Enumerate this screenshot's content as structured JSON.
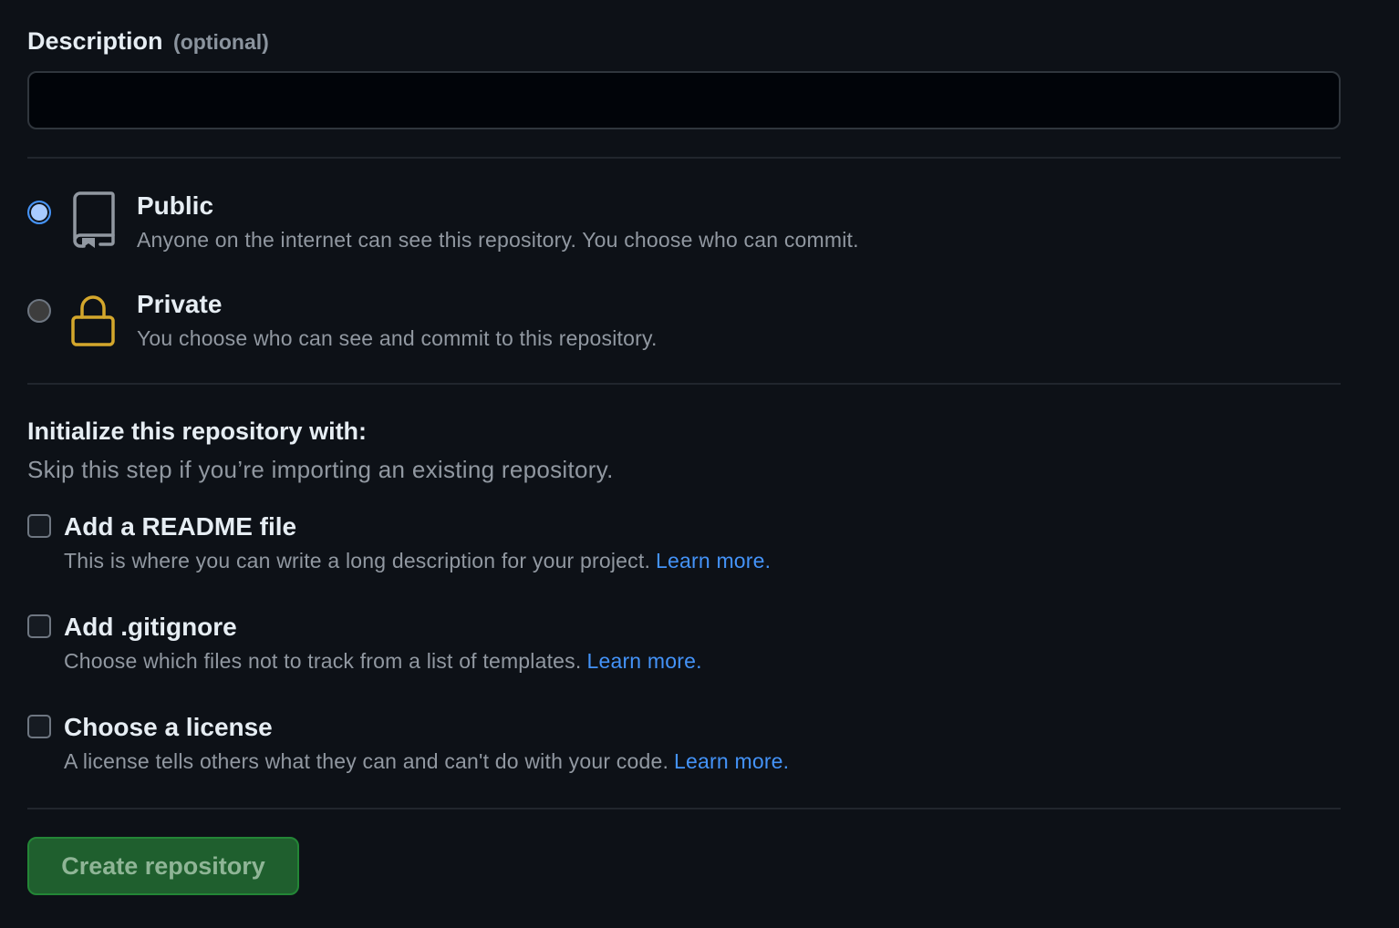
{
  "description": {
    "label": "Description",
    "optional_label": "(optional)",
    "value": "",
    "placeholder": ""
  },
  "visibility": {
    "options": [
      {
        "id": "public",
        "title": "Public",
        "description": "Anyone on the internet can see this repository. You choose who can commit.",
        "icon": "repo-icon",
        "checked": true
      },
      {
        "id": "private",
        "title": "Private",
        "description": "You choose who can see and commit to this repository.",
        "icon": "lock-icon",
        "checked": false
      }
    ]
  },
  "initialize": {
    "title": "Initialize this repository with:",
    "subtitle": "Skip this step if you’re importing an existing repository.",
    "options": [
      {
        "id": "readme",
        "title": "Add a README file",
        "description": "This is where you can write a long description for your project.",
        "link": "Learn more.",
        "checked": false
      },
      {
        "id": "gitignore",
        "title": "Add .gitignore",
        "description": "Choose which files not to track from a list of templates.",
        "link": "Learn more.",
        "checked": false
      },
      {
        "id": "license",
        "title": "Choose a license",
        "description": "A license tells others what they can and can't do with your code.",
        "link": "Learn more.",
        "checked": false
      }
    ]
  },
  "submit": {
    "label": "Create repository"
  },
  "colors": {
    "background": "#0d1117",
    "link": "#4493f8",
    "button": "#1f5f2e",
    "lock_icon": "#d4a72c",
    "repo_icon": "#9198a1"
  }
}
